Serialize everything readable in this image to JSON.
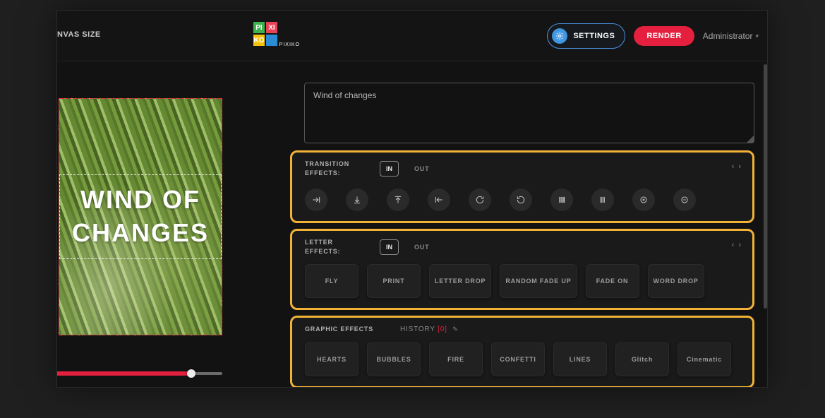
{
  "header": {
    "canvas_size_label": "NVAS SIZE",
    "logo": {
      "cells": [
        "PI",
        "XI",
        "KO",
        ""
      ],
      "subtext": "PIXIKO"
    },
    "settings_label": "SETTINGS",
    "render_label": "RENDER",
    "user_label": "Administrator"
  },
  "preview": {
    "overlay_text": "WIND OF CHANGES"
  },
  "text_input": {
    "value": "Wind of changes"
  },
  "transition": {
    "label": "TRANSITION EFFECTS:",
    "in_label": "IN",
    "out_label": "OUT",
    "icons": [
      "arrow-in-right",
      "arrow-in-down",
      "arrow-in-up",
      "arrow-in-left",
      "rotate-cw",
      "rotate-ccw",
      "venetian-solid",
      "venetian-lines",
      "zoom-in",
      "zoom-out"
    ]
  },
  "letter": {
    "label": "LETTER EFFECTS:",
    "in_label": "IN",
    "out_label": "OUT",
    "cards": [
      "FLY",
      "PRINT",
      "LETTER DROP",
      "RANDOM FADE UP",
      "FADE ON",
      "WORD DROP"
    ]
  },
  "graphic": {
    "label": "GRAPHIC EFFECTS",
    "history_label": "history",
    "history_count": "[0]",
    "cards": [
      "HEARTS",
      "BUBBLES",
      "FIRE",
      "CONFETTI",
      "LINES",
      "Glitch",
      "Cinematic"
    ]
  }
}
